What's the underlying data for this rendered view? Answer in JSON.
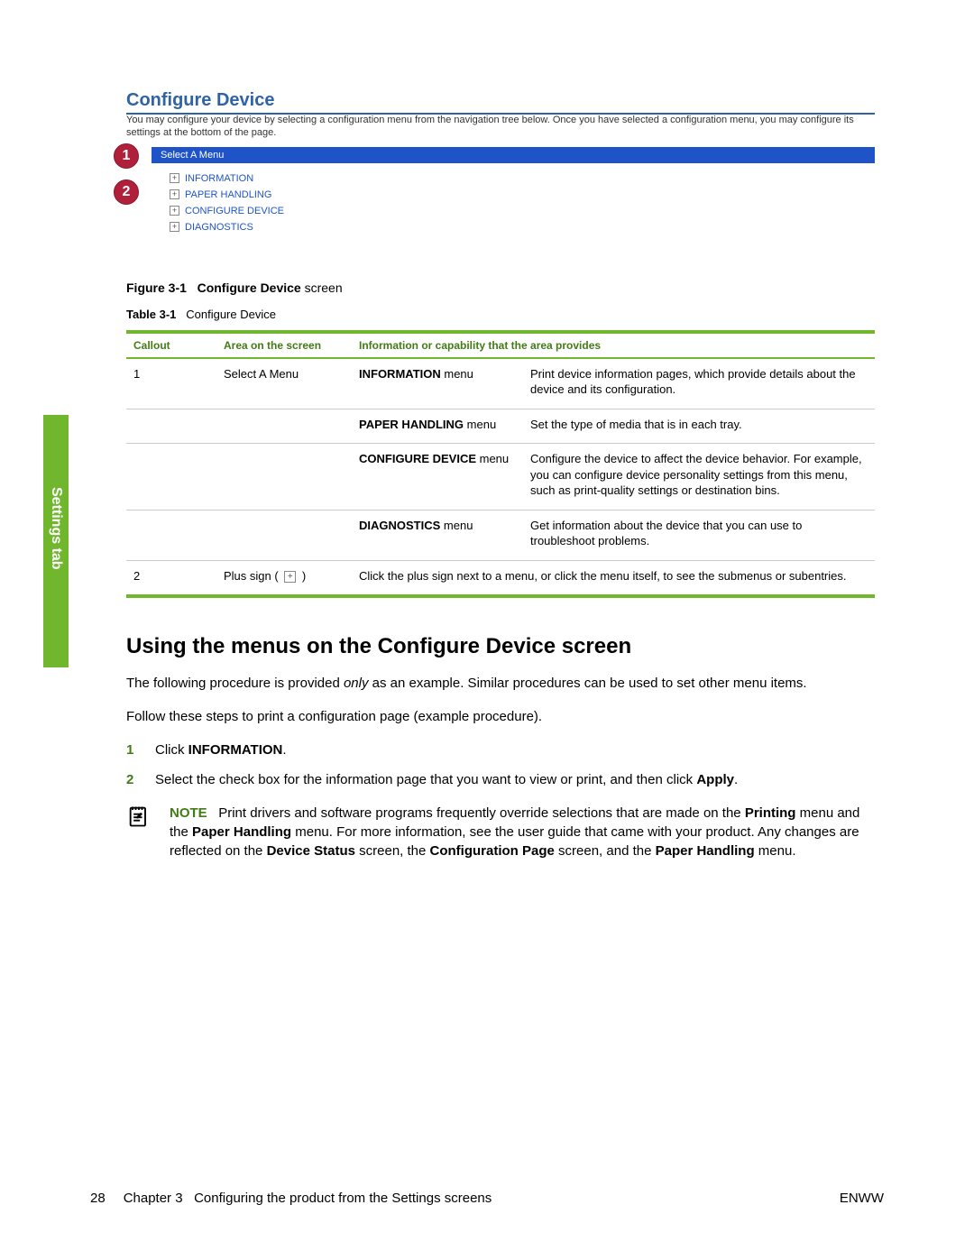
{
  "sidebar_tab": "Settings tab",
  "screenshot": {
    "title": "Configure Device",
    "description": "You may configure your device by selecting a configuration menu from the navigation tree below. Once you have selected a configuration menu, you may configure its settings at the bottom of the page.",
    "select_bar": "Select A Menu",
    "tree": [
      "INFORMATION",
      "PAPER HANDLING",
      "CONFIGURE DEVICE",
      "DIAGNOSTICS"
    ],
    "callouts": {
      "c1": "1",
      "c2": "2"
    }
  },
  "figure_caption": {
    "label": "Figure 3-1",
    "title_bold": "Configure Device",
    "title_rest": " screen"
  },
  "table_caption": {
    "label": "Table 3-1",
    "title": "Configure Device"
  },
  "table": {
    "headers": [
      "Callout",
      "Area on the screen",
      "Information or capability that the area provides"
    ],
    "rows": [
      {
        "callout": "1",
        "area": "Select A Menu",
        "menu_bold": "INFORMATION",
        "menu_suffix": " menu",
        "desc": "Print device information pages, which provide details about the device and its configuration."
      },
      {
        "callout": "",
        "area": "",
        "menu_bold": "PAPER HANDLING",
        "menu_suffix": " menu",
        "desc": "Set the type of media that is in each tray."
      },
      {
        "callout": "",
        "area": "",
        "menu_bold": "CONFIGURE DEVICE",
        "menu_suffix": " menu",
        "desc": "Configure the device to affect the device behavior. For example, you can configure device personality settings from this menu, such as print-quality settings or destination bins."
      },
      {
        "callout": "",
        "area": "",
        "menu_bold": "DIAGNOSTICS",
        "menu_suffix": " menu",
        "desc": "Get information about the device that you can use to troubleshoot problems."
      }
    ],
    "row2": {
      "callout": "2",
      "area_prefix": "Plus sign ( ",
      "area_suffix": " )",
      "desc": "Click the plus sign next to a menu, or click the menu itself, to see the submenus or subentries."
    }
  },
  "section_heading": "Using the menus on the Configure Device screen",
  "para1_a": "The following procedure is provided ",
  "para1_em": "only",
  "para1_b": " as an example. Similar procedures can be used to set other menu items.",
  "para2": "Follow these steps to print a configuration page (example procedure).",
  "steps": [
    {
      "num": "1",
      "pre": "Click ",
      "bold": "INFORMATION",
      "post": "."
    },
    {
      "num": "2",
      "pre": "Select the check box for the information page that you want to view or print, and then click ",
      "bold": "Apply",
      "post": "."
    }
  ],
  "note": {
    "label": "NOTE",
    "t1": "Print drivers and software programs frequently override selections that are made on the ",
    "b1": "Printing",
    "t2": " menu and the ",
    "b2": "Paper Handling",
    "t3": " menu. For more information, see the user guide that came with your product. Any changes are reflected on the ",
    "b3": "Device Status",
    "t4": " screen, the ",
    "b4": "Configuration Page",
    "t5": " screen, and the ",
    "b5": "Paper Handling",
    "t6": " menu."
  },
  "footer": {
    "page": "28",
    "chapter": "Chapter 3",
    "chapter_title": "Configuring the product from the Settings screens",
    "right": "ENWW"
  }
}
